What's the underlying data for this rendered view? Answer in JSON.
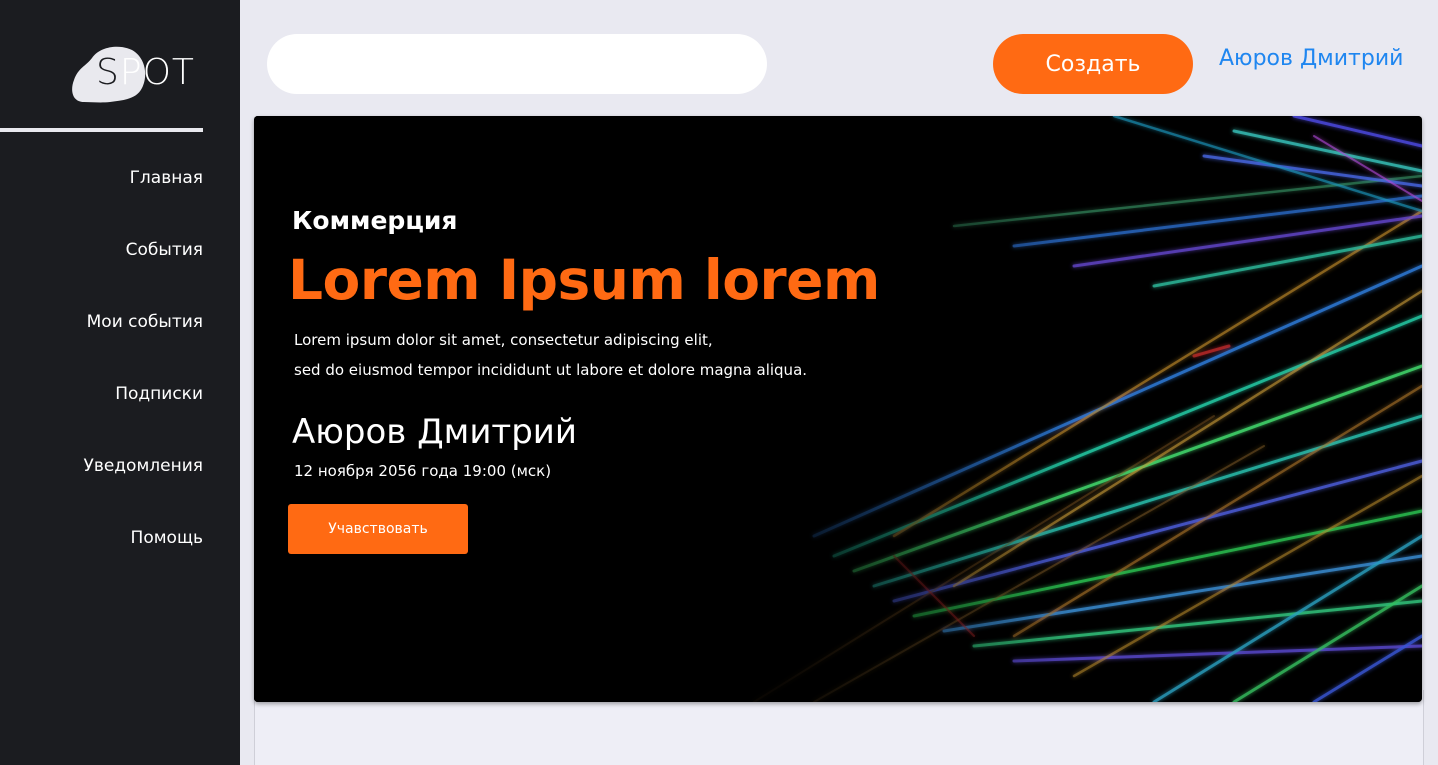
{
  "logo": {
    "first_letter": "S",
    "rest": "POT"
  },
  "nav": [
    {
      "label": "Главная"
    },
    {
      "label": "События"
    },
    {
      "label": "Мои события"
    },
    {
      "label": "Подписки"
    },
    {
      "label": "Уведомления"
    },
    {
      "label": "Помощь"
    }
  ],
  "header": {
    "search_placeholder": "",
    "create_label": "Создать",
    "user_name": "Аюров Дмитрий"
  },
  "hero": {
    "category": "Коммерция",
    "title": "Lorem Ipsum lorem",
    "description_line1": "Lorem ipsum dolor sit amet, consectetur adipiscing elit,",
    "description_line2": "sed do eiusmod tempor incididunt ut labore et dolore magna aliqua.",
    "author": "Аюров Дмитрий",
    "date": "12 ноября 2056 года 19:00 (мск)",
    "button_label": "Учавствовать"
  },
  "colors": {
    "accent": "#ff6a13",
    "link": "#1f86f0",
    "sidebar": "#1b1c20",
    "background": "#e9e9f1"
  },
  "icons": {
    "background_image": "neon-lines-image"
  }
}
